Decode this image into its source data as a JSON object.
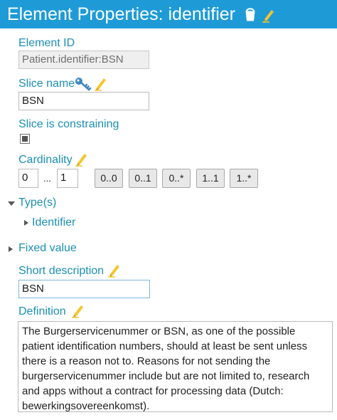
{
  "title": "Element Properties: identifier",
  "element_id": {
    "label": "Element ID",
    "value": "Patient.identifier:BSN"
  },
  "slice_name": {
    "label": "Slice name",
    "value": "BSN"
  },
  "slice_constraining": {
    "label": "Slice is constraining",
    "checked": true
  },
  "cardinality": {
    "label": "Cardinality",
    "min": "0",
    "separator": "...",
    "max": "1",
    "presets": [
      "0..0",
      "0..1",
      "0..*",
      "1..1",
      "1..*"
    ]
  },
  "types": {
    "label": "Type(s)",
    "expanded": true,
    "items": [
      "Identifier"
    ]
  },
  "fixed_value": {
    "label": "Fixed value",
    "expanded": false
  },
  "short_description": {
    "label": "Short description",
    "value": "BSN"
  },
  "definition": {
    "label": "Definition",
    "text": "The Burgerservicenummer or BSN, as one of the possible patient identification numbers, should at least be sent unless there is a reason not to. Reasons for not sending the burgerservicenummer include but are not limited to, research and apps without a contract for processing data (Dutch: bewerkingsovereenkomst)."
  },
  "colors": {
    "header_bg": "#1e9bd7",
    "label": "#1b8fb5",
    "edit_icon": "#f2c62f",
    "key_icon": "#3d87c2"
  },
  "icons": {
    "title": [
      "bucket-icon",
      "edit-pencil-icon"
    ],
    "slice_name": [
      "key-icon",
      "edit-pencil-icon"
    ]
  }
}
